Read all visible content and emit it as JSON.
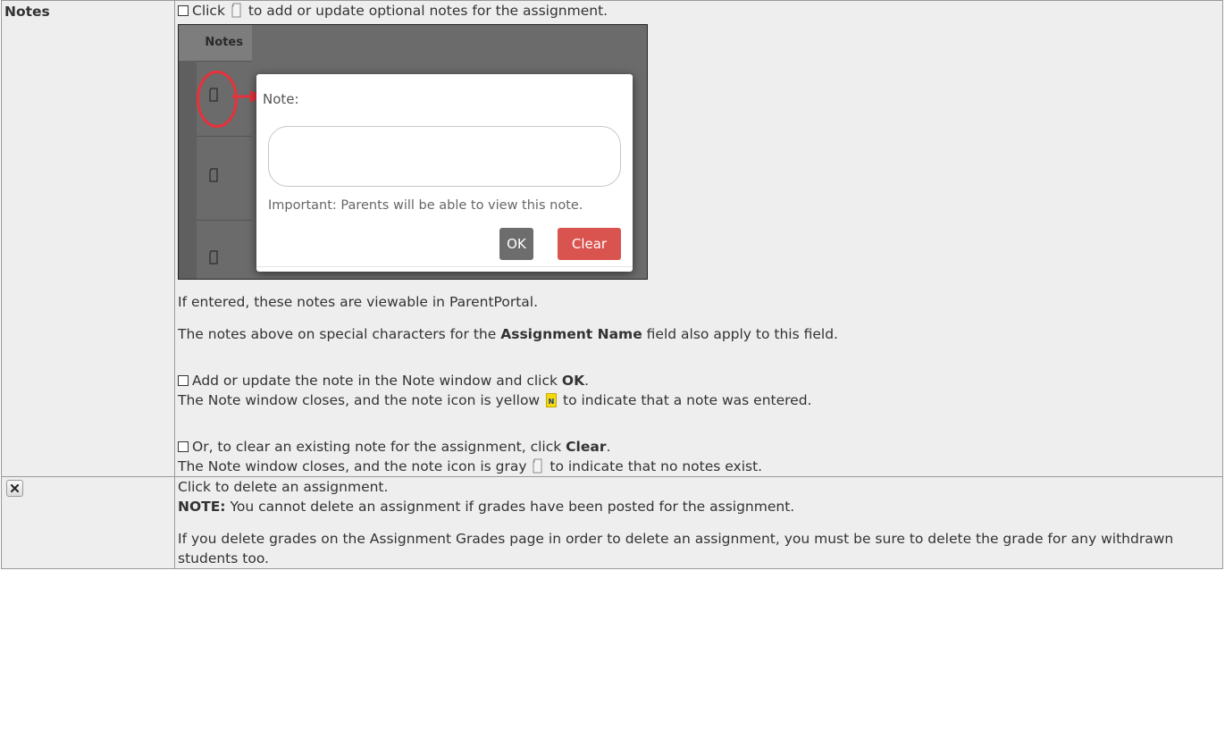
{
  "rows": [
    {
      "label": "Notes",
      "line1_pre": "Click",
      "line1_post": "to add or update optional notes for the assignment.",
      "screenshot": {
        "column_header": "Notes",
        "dialog_label": "Note:",
        "input_value": "",
        "help_text": "Important: Parents will be able to view this note.",
        "ok_label": "OK",
        "clear_label": "Clear",
        "colors": {
          "ok": "#6d6d6d",
          "clear": "#d9534f",
          "highlight": "#e8303a"
        }
      },
      "para1": "If entered, these notes are viewable in ParentPortal.",
      "para2_pre": "The notes above on special characters for the",
      "para2_bold": "Assignment Name",
      "para2_post": "field also apply to this field.",
      "step1_pre": "Add or update the note in the Note window and click",
      "step1_bold": "OK",
      "step1_post": ".",
      "step1_result_pre": "The Note window closes, and the note icon is yellow",
      "step1_result_post": "to indicate that a note was entered.",
      "step2_pre": "Or, to clear an existing note for the assignment, click",
      "step2_bold": "Clear",
      "step2_post": ".",
      "step2_result_pre": "The Note window closes, and the note icon is gray",
      "step2_result_post": "to indicate that no notes exist."
    },
    {
      "icon": "delete-x-icon",
      "line1": "Click to delete an assignment.",
      "note_bold": "NOTE:",
      "note_text": "You cannot delete an assignment if grades have been posted for the assignment.",
      "para": "If you delete grades on the Assignment Grades page in order to delete an assignment, you must be sure to delete the grade for any withdrawn students too."
    }
  ]
}
